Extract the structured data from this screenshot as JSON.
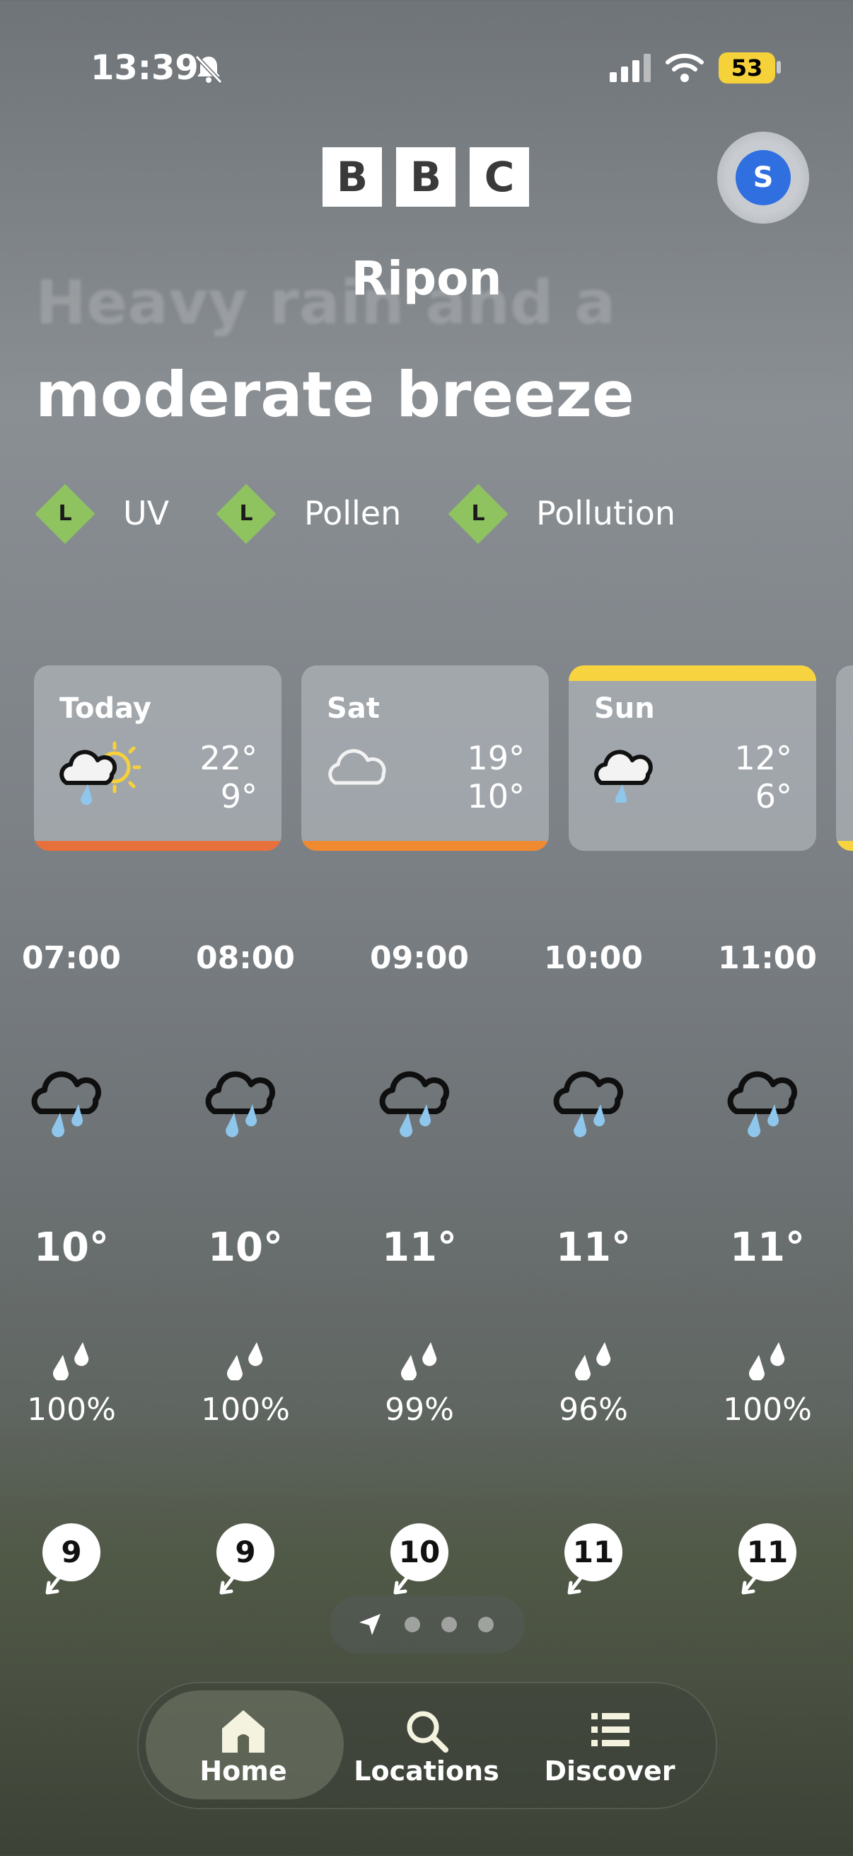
{
  "status_bar": {
    "time": "13:39",
    "battery": "53",
    "icons": [
      "bell-slash-icon",
      "cellular-signal-icon",
      "wifi-icon",
      "battery-icon"
    ]
  },
  "header": {
    "logo_letters": [
      "B",
      "B",
      "C"
    ],
    "avatar_initial": "S",
    "location": "Ripon"
  },
  "summary": {
    "line1": "Heavy rain and a",
    "line2": "moderate breeze"
  },
  "levels": [
    {
      "letter": "L",
      "label": "UV"
    },
    {
      "letter": "L",
      "label": "Pollen"
    },
    {
      "letter": "L",
      "label": "Pollution"
    }
  ],
  "days": [
    {
      "day": "Today",
      "high": "22°",
      "low": "9°",
      "icon": "sun-cloud-rain-icon",
      "bar_color": "#e8703a"
    },
    {
      "day": "Sat",
      "high": "19°",
      "low": "10°",
      "icon": "cloud-icon",
      "bar_color": "#f08a30"
    },
    {
      "day": "Sun",
      "high": "12°",
      "low": "6°",
      "icon": "cloud-rain-icon",
      "bar_color": "#f7d33f"
    }
  ],
  "hourly": [
    {
      "time": "07:00",
      "temp": "10°",
      "precip": "100%",
      "wind": "9",
      "icon": "heavy-rain-icon"
    },
    {
      "time": "08:00",
      "temp": "10°",
      "precip": "100%",
      "wind": "9",
      "icon": "heavy-rain-icon"
    },
    {
      "time": "09:00",
      "temp": "11°",
      "precip": "99%",
      "wind": "10",
      "icon": "heavy-rain-icon"
    },
    {
      "time": "10:00",
      "temp": "11°",
      "precip": "96%",
      "wind": "11",
      "icon": "heavy-rain-icon"
    },
    {
      "time": "11:00",
      "temp": "11°",
      "precip": "100%",
      "wind": "11",
      "icon": "heavy-rain-icon"
    }
  ],
  "pager": {
    "pages": 4,
    "current": 0
  },
  "tabs": [
    {
      "label": "Home",
      "icon": "home-icon",
      "active": true
    },
    {
      "label": "Locations",
      "icon": "search-icon",
      "active": false
    },
    {
      "label": "Discover",
      "icon": "list-icon",
      "active": false
    }
  ],
  "colors": {
    "level_badge": "#8fc360",
    "avatar": "#2f6fe0",
    "battery": "#f5d13a",
    "rain_drop": "#8fc6ec"
  }
}
